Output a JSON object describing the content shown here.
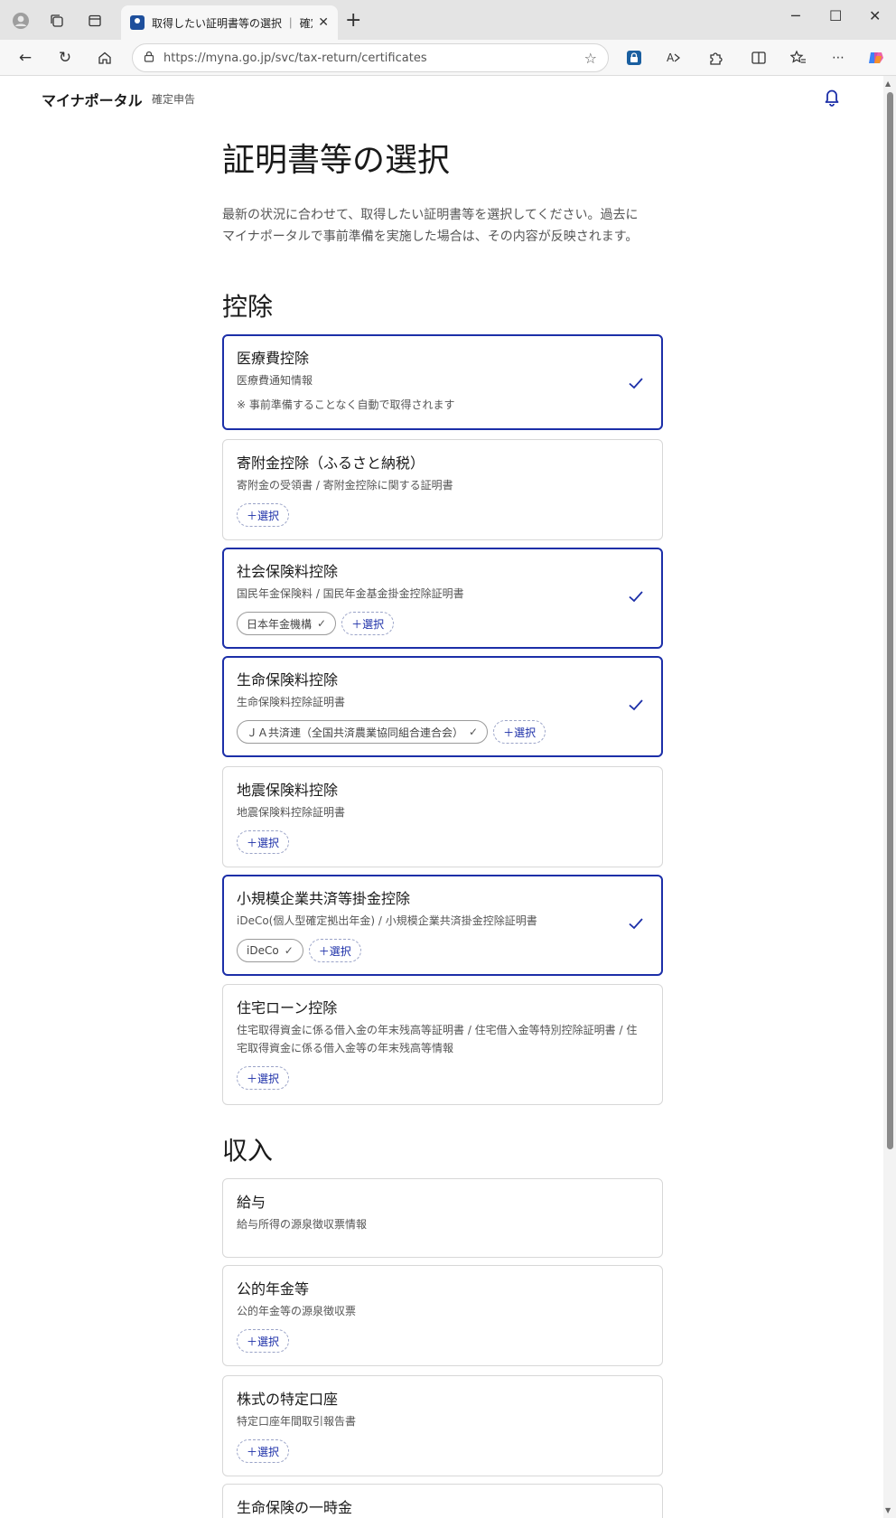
{
  "browser": {
    "tab_title": "取得したい証明書等の選択 ｜ 確定申告",
    "url": "https://myna.go.jp/svc/tax-return/certificates"
  },
  "header": {
    "brand": "マイナポータル",
    "sub": "確定申告"
  },
  "page": {
    "title": "証明書等の選択",
    "lead_1": "最新の状況に合わせて、取得したい証明書等を選択してください。過去に",
    "lead_2": "マイナポータルで事前準備を実施した場合は、その内容が反映されます。"
  },
  "sections": {
    "deduction": "控除",
    "income": "収入"
  },
  "cards": [
    {
      "title": "医療費控除",
      "desc": "医療費通知情報",
      "note": "※ 事前準備することなく自動で取得されます",
      "selected": true
    },
    {
      "title": "寄附金控除（ふるさと納税）",
      "desc": "寄附金の受領書 / 寄附金控除に関する証明書",
      "add": "＋選択",
      "selected": false
    },
    {
      "title": "社会保険料控除",
      "desc": "国民年金保険料 / 国民年金基金掛金控除証明書",
      "chip": "日本年金機構",
      "add": "＋選択",
      "selected": true
    },
    {
      "title": "生命保険料控除",
      "desc": "生命保険料控除証明書",
      "chip": "ＪＡ共済連（全国共済農業協同組合連合会）",
      "add": "＋選択",
      "selected": true
    },
    {
      "title": "地震保険料控除",
      "desc": "地震保険料控除証明書",
      "add": "＋選択",
      "selected": false
    },
    {
      "title": "小規模企業共済等掛金控除",
      "desc": "iDeCo(個人型確定拠出年金) / 小規模企業共済掛金控除証明書",
      "chip": "iDeCo",
      "add": "＋選択",
      "selected": true
    },
    {
      "title": "住宅ローン控除",
      "desc_1": "住宅取得資金に係る借入金の年末残高等証明書 / 住宅借入金等特別控除証明書 / 住",
      "desc_2": "宅取得資金に係る借入金等の年末残高等情報",
      "add": "＋選択",
      "selected": false
    },
    {
      "title": "給与",
      "desc": "給与所得の源泉徴収票情報",
      "selected": false
    },
    {
      "title": "公的年金等",
      "desc": "公的年金等の源泉徴収票",
      "add": "＋選択",
      "selected": false
    },
    {
      "title": "株式の特定口座",
      "desc": "特定口座年間取引報告書",
      "add": "＋選択",
      "selected": false
    },
    {
      "title": "生命保険の一時金",
      "selected": false
    }
  ],
  "colors": {
    "accent": "#1c2fa8",
    "border": "#d7d7d7"
  }
}
